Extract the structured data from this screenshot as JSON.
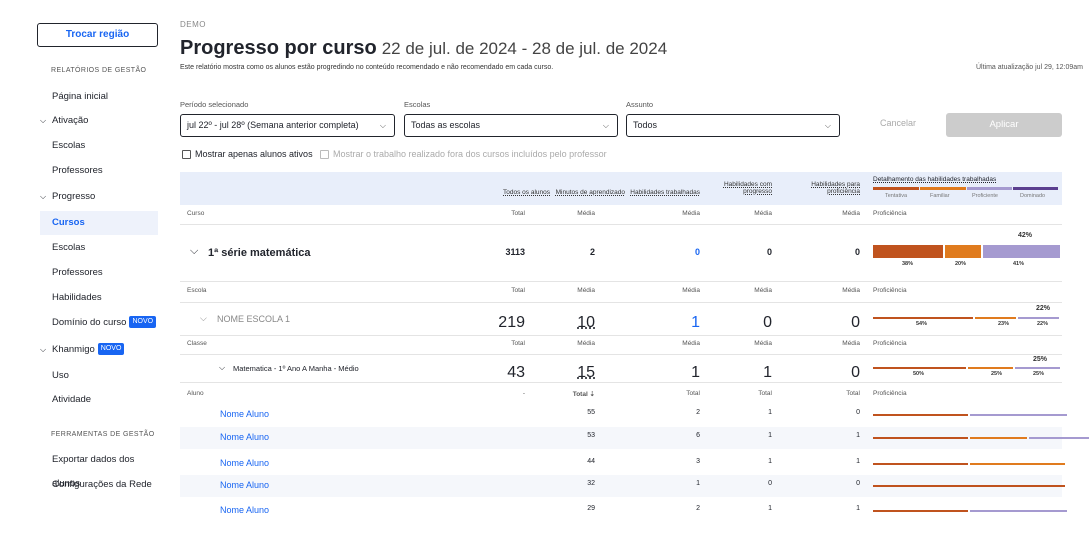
{
  "sidebar": {
    "region_button": "Trocar região",
    "section_reports": "RELATÓRIOS DE GESTÃO",
    "home": "Página inicial",
    "activation": "Ativação",
    "act_schools": "Escolas",
    "act_teachers": "Professores",
    "progress": "Progresso",
    "prog_courses": "Cursos",
    "prog_schools": "Escolas",
    "prog_teachers": "Professores",
    "prog_skills": "Habilidades",
    "mastery": "Domínio do curso",
    "mastery_badge": "NOVO",
    "khanmigo": "Khanmigo",
    "khanmigo_badge": "NOVO",
    "usage": "Uso",
    "activity": "Atividade",
    "section_tools": "FERRAMENTAS DE GESTÃO",
    "export": "Exportar dados dos alunos",
    "network": "Configurações da Rede"
  },
  "header": {
    "demo": "DEMO",
    "title": "Progresso por curso",
    "dates": "22 de jul. de 2024 - 28 de jul. de 2024",
    "description": "Este relatório mostra como os alunos estão progredindo no conteúdo recomendado e não recomendado em cada curso.",
    "updated": "Última atualização jul 29, 12:09am"
  },
  "filters": {
    "period_label": "Período selecionado",
    "period_value": "jul 22º - jul 28º (Semana anterior completa)",
    "schools_label": "Escolas",
    "schools_value": "Todas as escolas",
    "subject_label": "Assunto",
    "subject_value": "Todos",
    "cancel": "Cancelar",
    "apply": "Aplicar",
    "active_only": "Mostrar apenas alunos ativos",
    "outside_work": "Mostrar o trabalho realizado fora dos cursos incluídos pelo professor"
  },
  "table": {
    "headers": {
      "all_students": "Todos os alunos",
      "minutes": "Minutos de aprendizado",
      "skills_worked": "Habilidades trabalhadas",
      "skills_progress": "Habilidades com progresso",
      "skills_prof": "Habilidades para proficiência",
      "breakdown": "Detalhamento das habilidades trabalhadas"
    },
    "legend": {
      "tentativa": "Tentativa",
      "familiar": "Familiar",
      "proficiente": "Proficiente",
      "dominado": "Dominado"
    },
    "colors": {
      "tentativa": "#c0531e",
      "familiar": "#e07b1e",
      "proficiente": "#a59ad0",
      "dominado": "#5b3f8f"
    },
    "sub": {
      "curso": "Curso",
      "escola": "Escola",
      "classe": "Classe",
      "aluno": "Aluno",
      "total": "Total",
      "media": "Média",
      "proficiencia": "Proficiência",
      "dash": "-"
    },
    "course": {
      "name": "1ª série matemática",
      "total": "3113",
      "minutes": "2",
      "skills": "0",
      "progress": "0",
      "prof": "0",
      "top": "42%",
      "p1": "38%",
      "p2": "20%",
      "p3": "41%",
      "v1": 38,
      "v2": 20,
      "v3": 41
    },
    "school": {
      "name": "NOME ESCOLA 1",
      "total": "219",
      "minutes": "10",
      "skills": "1",
      "progress": "0",
      "prof": "0",
      "top": "22%",
      "p1": "54%",
      "p2": "23%",
      "p3": "22%",
      "v1": 54,
      "v2": 23,
      "v3": 22
    },
    "class": {
      "name": "Matematica - 1º Ano A Manha - Médio",
      "total": "43",
      "minutes": "15",
      "skills": "1",
      "progress": "1",
      "prof": "0",
      "top": "25%",
      "p1": "50%",
      "p2": "25%",
      "p3": "25%",
      "v1": 50,
      "v2": 25,
      "v3": 25
    },
    "students": [
      {
        "name": "Nome Aluno",
        "total": "55",
        "skills": "2",
        "progress": "1",
        "prof": "0"
      },
      {
        "name": "Nome Aluno",
        "total": "53",
        "skills": "6",
        "progress": "1",
        "prof": "1"
      },
      {
        "name": "Nome Aluno",
        "total": "44",
        "skills": "3",
        "progress": "1",
        "prof": "1"
      },
      {
        "name": "Nome Aluno",
        "total": "32",
        "skills": "1",
        "progress": "0",
        "prof": "0"
      },
      {
        "name": "Nome Aluno",
        "total": "29",
        "skills": "2",
        "progress": "1",
        "prof": "1"
      }
    ],
    "total_sort": "Total ⇣"
  }
}
